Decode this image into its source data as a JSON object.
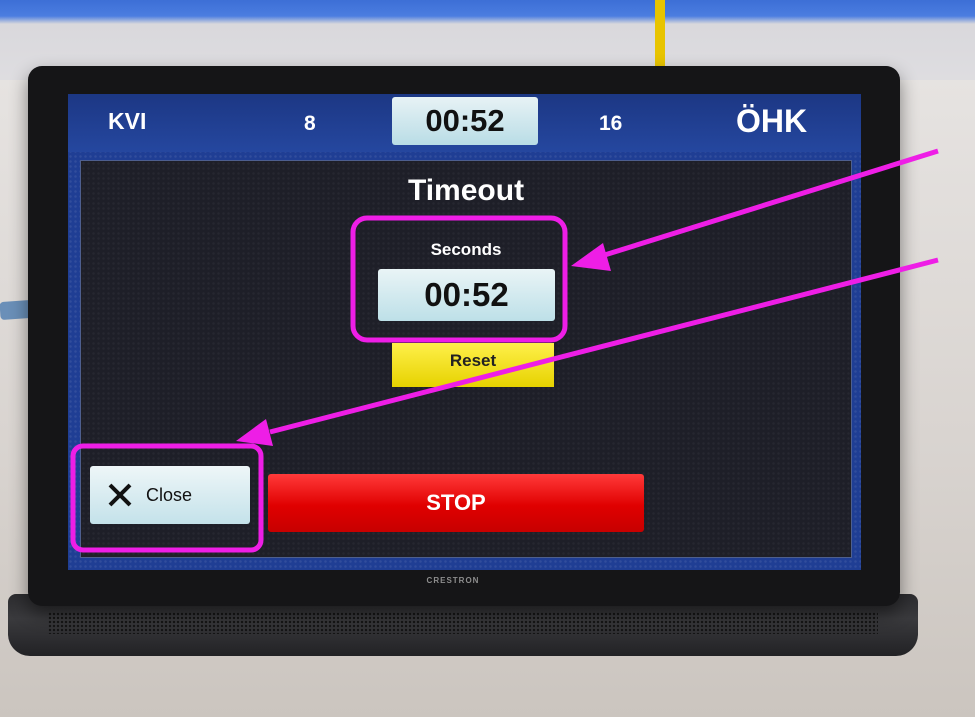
{
  "scoreboard": {
    "home_team": "KVI",
    "home_score": "8",
    "clock": "00:52",
    "away_score": "16",
    "away_team": "ÖHK"
  },
  "timeout_panel": {
    "title": "Timeout",
    "seconds_label": "Seconds",
    "seconds_value": "00:52",
    "reset_label": "Reset",
    "close_label": "Close",
    "stop_label": "STOP"
  },
  "device": {
    "brand": "CRESTRON"
  },
  "icons": {
    "close": "close-icon"
  },
  "colors": {
    "screen_blue": "#1f3e94",
    "reset_yellow": "#f5e31a",
    "stop_red": "#e00000",
    "annotation_magenta": "#ee1ee6"
  }
}
